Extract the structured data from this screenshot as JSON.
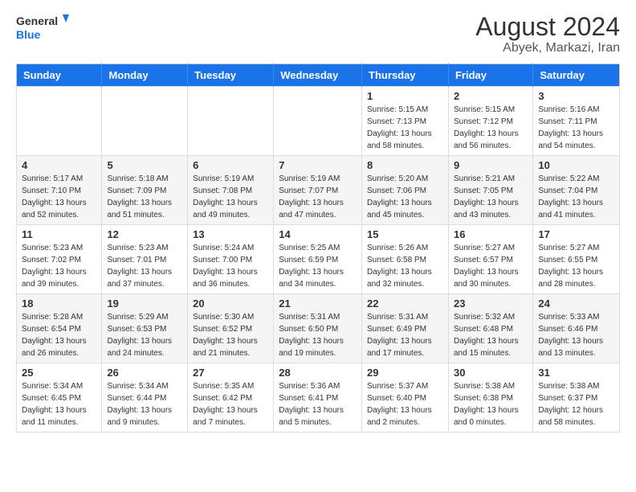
{
  "logo": {
    "text_general": "General",
    "text_blue": "Blue"
  },
  "title": {
    "month_year": "August 2024",
    "location": "Abyek, Markazi, Iran"
  },
  "weekdays": [
    "Sunday",
    "Monday",
    "Tuesday",
    "Wednesday",
    "Thursday",
    "Friday",
    "Saturday"
  ],
  "weeks": [
    [
      {
        "day": "",
        "info": ""
      },
      {
        "day": "",
        "info": ""
      },
      {
        "day": "",
        "info": ""
      },
      {
        "day": "",
        "info": ""
      },
      {
        "day": "1",
        "info": "Sunrise: 5:15 AM\nSunset: 7:13 PM\nDaylight: 13 hours\nand 58 minutes."
      },
      {
        "day": "2",
        "info": "Sunrise: 5:15 AM\nSunset: 7:12 PM\nDaylight: 13 hours\nand 56 minutes."
      },
      {
        "day": "3",
        "info": "Sunrise: 5:16 AM\nSunset: 7:11 PM\nDaylight: 13 hours\nand 54 minutes."
      }
    ],
    [
      {
        "day": "4",
        "info": "Sunrise: 5:17 AM\nSunset: 7:10 PM\nDaylight: 13 hours\nand 52 minutes."
      },
      {
        "day": "5",
        "info": "Sunrise: 5:18 AM\nSunset: 7:09 PM\nDaylight: 13 hours\nand 51 minutes."
      },
      {
        "day": "6",
        "info": "Sunrise: 5:19 AM\nSunset: 7:08 PM\nDaylight: 13 hours\nand 49 minutes."
      },
      {
        "day": "7",
        "info": "Sunrise: 5:19 AM\nSunset: 7:07 PM\nDaylight: 13 hours\nand 47 minutes."
      },
      {
        "day": "8",
        "info": "Sunrise: 5:20 AM\nSunset: 7:06 PM\nDaylight: 13 hours\nand 45 minutes."
      },
      {
        "day": "9",
        "info": "Sunrise: 5:21 AM\nSunset: 7:05 PM\nDaylight: 13 hours\nand 43 minutes."
      },
      {
        "day": "10",
        "info": "Sunrise: 5:22 AM\nSunset: 7:04 PM\nDaylight: 13 hours\nand 41 minutes."
      }
    ],
    [
      {
        "day": "11",
        "info": "Sunrise: 5:23 AM\nSunset: 7:02 PM\nDaylight: 13 hours\nand 39 minutes."
      },
      {
        "day": "12",
        "info": "Sunrise: 5:23 AM\nSunset: 7:01 PM\nDaylight: 13 hours\nand 37 minutes."
      },
      {
        "day": "13",
        "info": "Sunrise: 5:24 AM\nSunset: 7:00 PM\nDaylight: 13 hours\nand 36 minutes."
      },
      {
        "day": "14",
        "info": "Sunrise: 5:25 AM\nSunset: 6:59 PM\nDaylight: 13 hours\nand 34 minutes."
      },
      {
        "day": "15",
        "info": "Sunrise: 5:26 AM\nSunset: 6:58 PM\nDaylight: 13 hours\nand 32 minutes."
      },
      {
        "day": "16",
        "info": "Sunrise: 5:27 AM\nSunset: 6:57 PM\nDaylight: 13 hours\nand 30 minutes."
      },
      {
        "day": "17",
        "info": "Sunrise: 5:27 AM\nSunset: 6:55 PM\nDaylight: 13 hours\nand 28 minutes."
      }
    ],
    [
      {
        "day": "18",
        "info": "Sunrise: 5:28 AM\nSunset: 6:54 PM\nDaylight: 13 hours\nand 26 minutes."
      },
      {
        "day": "19",
        "info": "Sunrise: 5:29 AM\nSunset: 6:53 PM\nDaylight: 13 hours\nand 24 minutes."
      },
      {
        "day": "20",
        "info": "Sunrise: 5:30 AM\nSunset: 6:52 PM\nDaylight: 13 hours\nand 21 minutes."
      },
      {
        "day": "21",
        "info": "Sunrise: 5:31 AM\nSunset: 6:50 PM\nDaylight: 13 hours\nand 19 minutes."
      },
      {
        "day": "22",
        "info": "Sunrise: 5:31 AM\nSunset: 6:49 PM\nDaylight: 13 hours\nand 17 minutes."
      },
      {
        "day": "23",
        "info": "Sunrise: 5:32 AM\nSunset: 6:48 PM\nDaylight: 13 hours\nand 15 minutes."
      },
      {
        "day": "24",
        "info": "Sunrise: 5:33 AM\nSunset: 6:46 PM\nDaylight: 13 hours\nand 13 minutes."
      }
    ],
    [
      {
        "day": "25",
        "info": "Sunrise: 5:34 AM\nSunset: 6:45 PM\nDaylight: 13 hours\nand 11 minutes."
      },
      {
        "day": "26",
        "info": "Sunrise: 5:34 AM\nSunset: 6:44 PM\nDaylight: 13 hours\nand 9 minutes."
      },
      {
        "day": "27",
        "info": "Sunrise: 5:35 AM\nSunset: 6:42 PM\nDaylight: 13 hours\nand 7 minutes."
      },
      {
        "day": "28",
        "info": "Sunrise: 5:36 AM\nSunset: 6:41 PM\nDaylight: 13 hours\nand 5 minutes."
      },
      {
        "day": "29",
        "info": "Sunrise: 5:37 AM\nSunset: 6:40 PM\nDaylight: 13 hours\nand 2 minutes."
      },
      {
        "day": "30",
        "info": "Sunrise: 5:38 AM\nSunset: 6:38 PM\nDaylight: 13 hours\nand 0 minutes."
      },
      {
        "day": "31",
        "info": "Sunrise: 5:38 AM\nSunset: 6:37 PM\nDaylight: 12 hours\nand 58 minutes."
      }
    ]
  ]
}
